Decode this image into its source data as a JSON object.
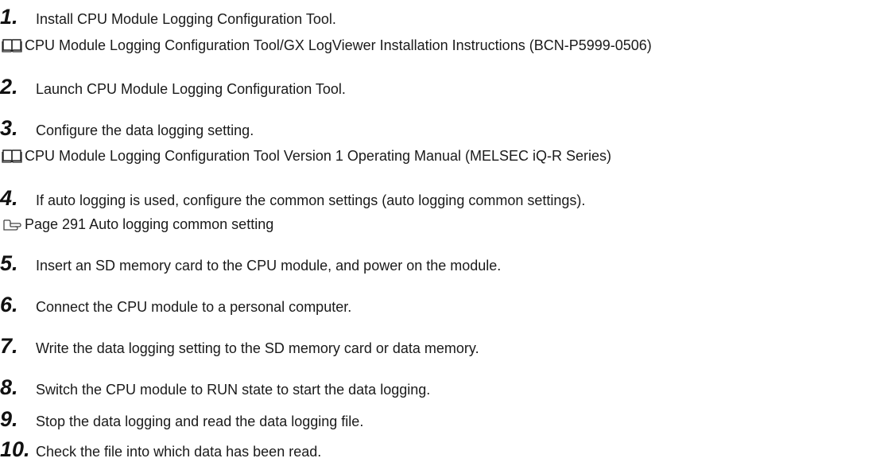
{
  "steps": [
    {
      "number": "1.",
      "text": "Install CPU Module Logging Configuration Tool."
    },
    {
      "number": "2.",
      "text": "Launch CPU Module Logging Configuration Tool."
    },
    {
      "number": "3.",
      "text": "Configure the data logging setting."
    },
    {
      "number": "4.",
      "text": "If auto logging is used, configure the common settings (auto logging common settings)."
    },
    {
      "number": "5.",
      "text": "Insert an SD memory card to the CPU module, and power on the module."
    },
    {
      "number": "6.",
      "text": "Connect the CPU module to a personal computer."
    },
    {
      "number": "7.",
      "text": "Write the data logging setting to the SD memory card or data memory."
    },
    {
      "number": "8.",
      "text": "Switch the CPU module to RUN state to start the data logging."
    },
    {
      "number": "9.",
      "text": "Stop the data logging and read the data logging file."
    },
    {
      "number": "10.",
      "text": "Check the file into which data has been read."
    }
  ],
  "references": [
    {
      "icon": "manual-book-icon",
      "text": "CPU Module Logging Configuration Tool/GX LogViewer Installation Instructions (BCN-P5999-0506)"
    },
    {
      "icon": "manual-book-icon",
      "text": "CPU Module Logging Configuration Tool Version 1 Operating Manual (MELSEC iQ-R Series)"
    },
    {
      "icon": "page-reference-icon",
      "text": "Page 291 Auto logging common setting"
    }
  ]
}
